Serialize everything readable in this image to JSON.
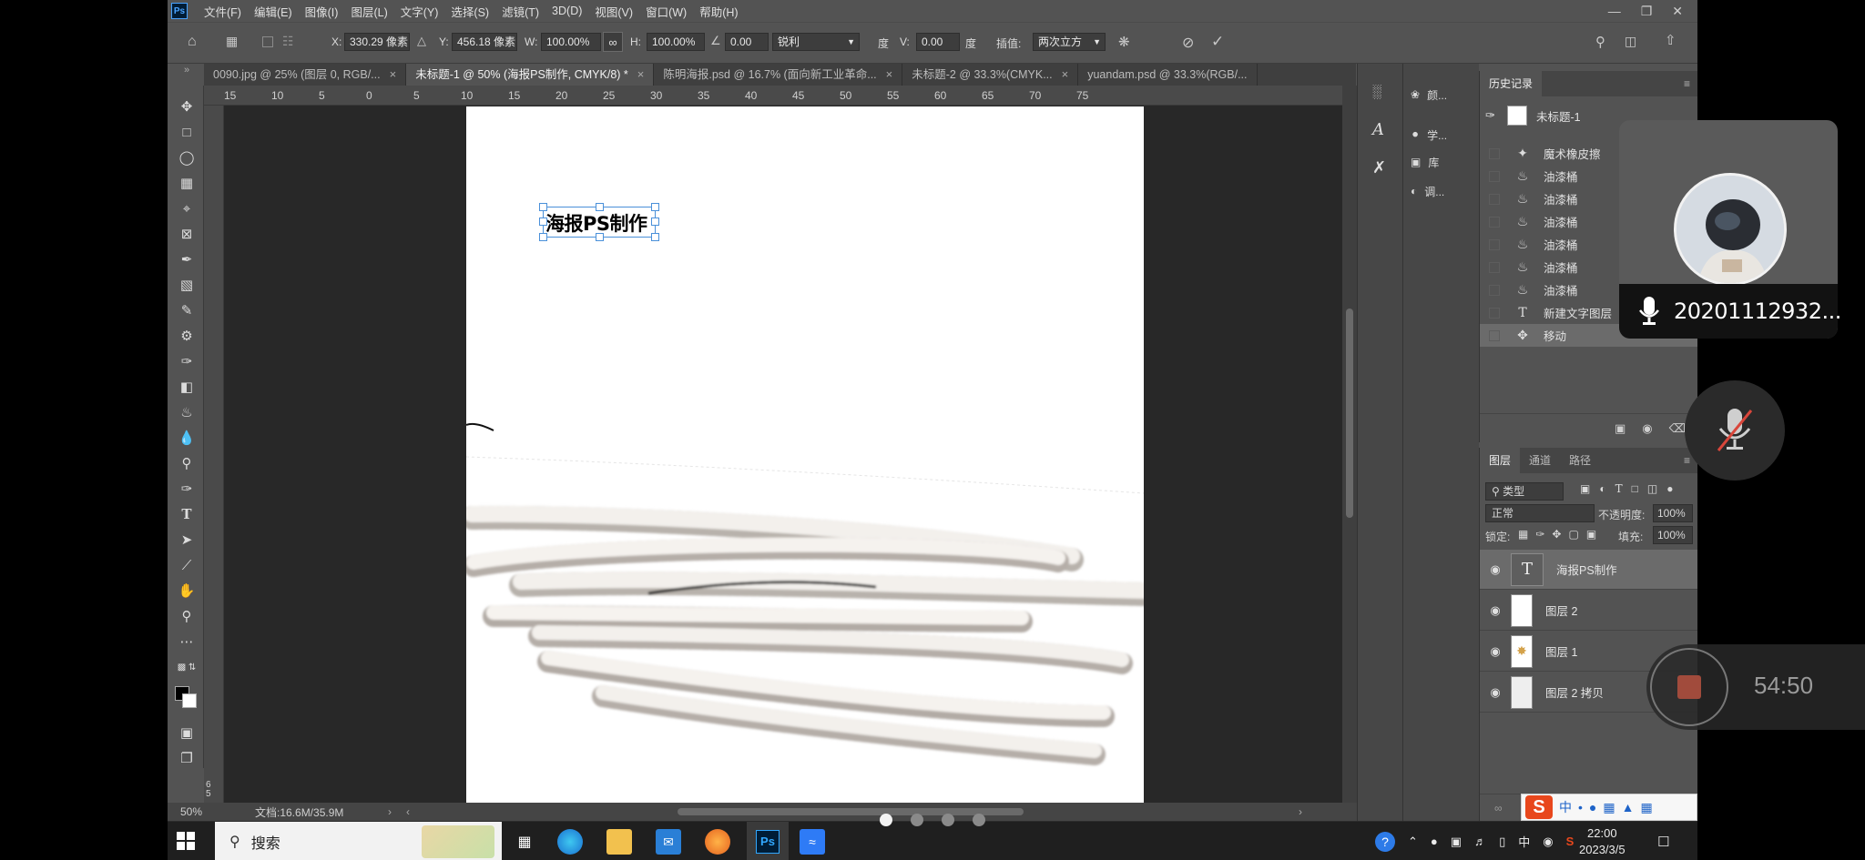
{
  "menu": {
    "items": [
      "文件(F)",
      "编辑(E)",
      "图像(I)",
      "图层(L)",
      "文字(Y)",
      "选择(S)",
      "滤镜(T)",
      "3D(D)",
      "视图(V)",
      "窗口(W)",
      "帮助(H)"
    ],
    "app_badge": "Ps"
  },
  "options": {
    "x_label": "X:",
    "x_value": "330.29 像素",
    "y_label": "Y:",
    "y_value": "456.18 像素",
    "w_label": "W:",
    "w_value": "100.00%",
    "h_label": "H:",
    "h_value": "100.00%",
    "angle_value": "0.00",
    "interp_mode": "锐利",
    "degree_unit_1": "度",
    "v_label": "V:",
    "v_value": "0.00",
    "degree_unit_2": "度",
    "interp_label": "插值:",
    "interp_value": "两次立方"
  },
  "tabs": [
    {
      "label": "0090.jpg @ 25% (图层 0, RGB/...",
      "active": false
    },
    {
      "label": "未标题-1 @ 50% (海报PS制作, CMYK/8) *",
      "active": true
    },
    {
      "label": "陈明海报.psd @ 16.7% (面向新工业革命...",
      "active": false
    },
    {
      "label": "未标题-2 @ 33.3%(CMYK...",
      "active": false
    },
    {
      "label": "yuandam.psd @ 33.3%(RGB/...",
      "active": false
    }
  ],
  "ruler": {
    "ticks": [
      "15",
      "10",
      "5",
      "0",
      "5",
      "10",
      "15",
      "20",
      "25",
      "30",
      "35",
      "40",
      "45",
      "50",
      "55",
      "60",
      "65",
      "70",
      "75"
    ],
    "left_label": "65"
  },
  "canvas": {
    "text_layer": "海报PS制作"
  },
  "status": {
    "zoom": "50%",
    "doc_size": "文档:16.6M/35.9M"
  },
  "dock": {
    "items": [
      {
        "icon": "palette-icon",
        "label": "颜..."
      },
      {
        "icon": "lightbulb-icon",
        "label": "学..."
      },
      {
        "icon": "library-icon",
        "label": "库"
      },
      {
        "icon": "adjustments-icon",
        "label": "调..."
      }
    ]
  },
  "history": {
    "tab": "历史记录",
    "snapshot": "未标题-1",
    "items": [
      {
        "icon": "magic-eraser-icon",
        "label": "魔术橡皮擦",
        "selected": false
      },
      {
        "icon": "paint-bucket-icon",
        "label": "油漆桶",
        "selected": false
      },
      {
        "icon": "paint-bucket-icon",
        "label": "油漆桶",
        "selected": false
      },
      {
        "icon": "paint-bucket-icon",
        "label": "油漆桶",
        "selected": false
      },
      {
        "icon": "paint-bucket-icon",
        "label": "油漆桶",
        "selected": false
      },
      {
        "icon": "paint-bucket-icon",
        "label": "油漆桶",
        "selected": false
      },
      {
        "icon": "paint-bucket-icon",
        "label": "油漆桶",
        "selected": false
      },
      {
        "icon": "text-icon",
        "label": "新建文字图层",
        "selected": false
      },
      {
        "icon": "move-icon",
        "label": "移动",
        "selected": true
      }
    ]
  },
  "layers": {
    "tabs": [
      "图层",
      "通道",
      "路径"
    ],
    "filter_label": "类型",
    "blend_mode": "正常",
    "opacity_label": "不透明度:",
    "opacity_value": "100%",
    "lock_label": "锁定:",
    "fill_label": "填充:",
    "fill_value": "100%",
    "items": [
      {
        "name": "海报PS制作",
        "kind": "text",
        "selected": true
      },
      {
        "name": "图层 2",
        "kind": "raster",
        "selected": false
      },
      {
        "name": "图层 1",
        "kind": "raster",
        "selected": false
      },
      {
        "name": "图层 2 拷贝",
        "kind": "raster",
        "selected": false
      }
    ]
  },
  "taskbar": {
    "search_placeholder": "搜索",
    "time": "22:00",
    "date": "2023/3/5",
    "ime_lang": "中"
  },
  "call": {
    "caller_id": "20201112932...",
    "record_time": "54:50"
  },
  "ime_bar": {
    "logo": "S",
    "mode": "中"
  },
  "colors": {
    "panel": "#535353",
    "pasteboard": "#282828",
    "accent_blue": "#4aa3ff",
    "record_red": "#a14b3c"
  }
}
